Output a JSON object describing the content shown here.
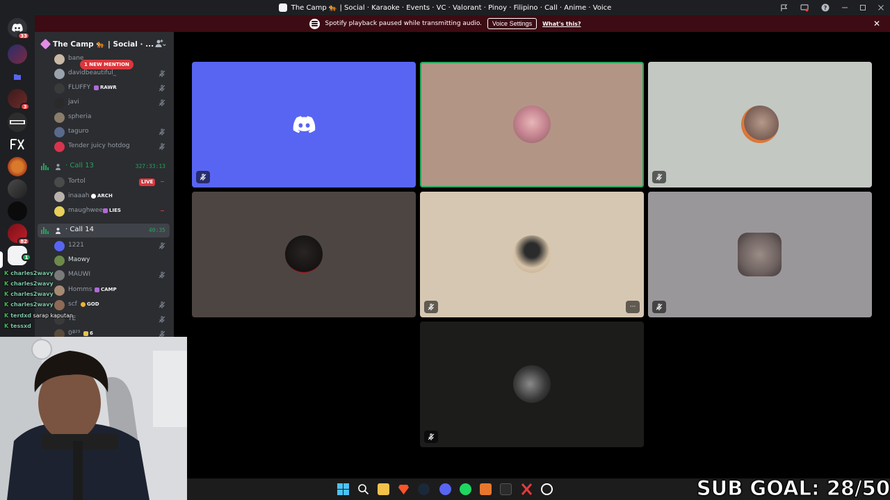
{
  "window": {
    "title": "The Camp 🐅 | Social · Karaoke · Events · VC · Valorant · Pinoy · Filipino · Call · Anime · Voice"
  },
  "notice": {
    "text": "Spotify playback paused while transmitting audio.",
    "button_label": "Voice Settings",
    "link_label": "What's this?",
    "close_glyph": "✕"
  },
  "rail": {
    "home_badge": "33",
    "badges": [
      "3",
      "82",
      "1"
    ]
  },
  "server": {
    "name": "The Camp 🐅 | Social · ...",
    "new_mention": "1 NEW MENTION"
  },
  "voice": {
    "top_members": [
      {
        "name": "bane",
        "tag": ""
      },
      {
        "name": "davidbeautiful_",
        "tag": ""
      },
      {
        "name": "FLUFFY",
        "tag": "RAWR"
      },
      {
        "name": "javi",
        "tag": ""
      },
      {
        "name": "spheria",
        "tag": ""
      },
      {
        "name": "taguro",
        "tag": ""
      },
      {
        "name": "Tender juicy hotdog",
        "tag": ""
      }
    ],
    "call13": {
      "prefix": "·",
      "name": "Call 13",
      "time": "327:33:13",
      "members": [
        {
          "name": "Tortol",
          "live": "LIVE"
        },
        {
          "name": "inaaah",
          "tag": "ARCH"
        },
        {
          "name": "maughwee",
          "tag": "LIES"
        }
      ]
    },
    "call14": {
      "prefix": "·",
      "name": "Call 14",
      "time": "40:35",
      "members": [
        {
          "name": "1221",
          "tag": ""
        },
        {
          "name": "Maowy",
          "tag": ""
        },
        {
          "name": "MAUWI",
          "tag": ""
        },
        {
          "name": "Homms",
          "tag": "CAMP"
        },
        {
          "name": "scf",
          "tag": "GOD"
        },
        {
          "name": "YE",
          "tag": ""
        },
        {
          "name": "0ª²³",
          "tag": "6"
        }
      ]
    }
  },
  "chat": [
    {
      "user": "charles2wavy",
      "msg": ""
    },
    {
      "user": "charles2wavy",
      "msg": ""
    },
    {
      "user": "charles2wavy",
      "msg": ""
    },
    {
      "user": "charles2wavy",
      "msg": ""
    },
    {
      "user": "terdxd",
      "msg": "sarap kaputan"
    },
    {
      "user": "tessxd",
      "msg": ""
    }
  ],
  "colors": {
    "discord_blurple": "#5865f2",
    "speaking_green": "#23a55a",
    "notice_bg": "#3d0b13",
    "tile_1": "#5865f2",
    "tile_2": "#b39585",
    "tile_3": "#c3c8c3",
    "tile_4": "#4d4542",
    "tile_5": "#d6c7b3",
    "tile_6": "#9a979a",
    "tile_7": "#1c1c1b"
  },
  "tiles": [
    {
      "kind": "discord-logo",
      "muted": true,
      "speaking": false
    },
    {
      "kind": "avatar",
      "muted": false,
      "speaking": true
    },
    {
      "kind": "avatar",
      "muted": true,
      "speaking": false
    },
    {
      "kind": "avatar",
      "muted": false,
      "speaking": false
    },
    {
      "kind": "avatar",
      "muted": true,
      "speaking": false,
      "more": "···"
    },
    {
      "kind": "avatar",
      "muted": true,
      "speaking": false
    },
    {
      "kind": "avatar",
      "muted": true,
      "speaking": false
    }
  ],
  "overlay": {
    "sub_goal": "SUB GOAL: 28/50"
  }
}
